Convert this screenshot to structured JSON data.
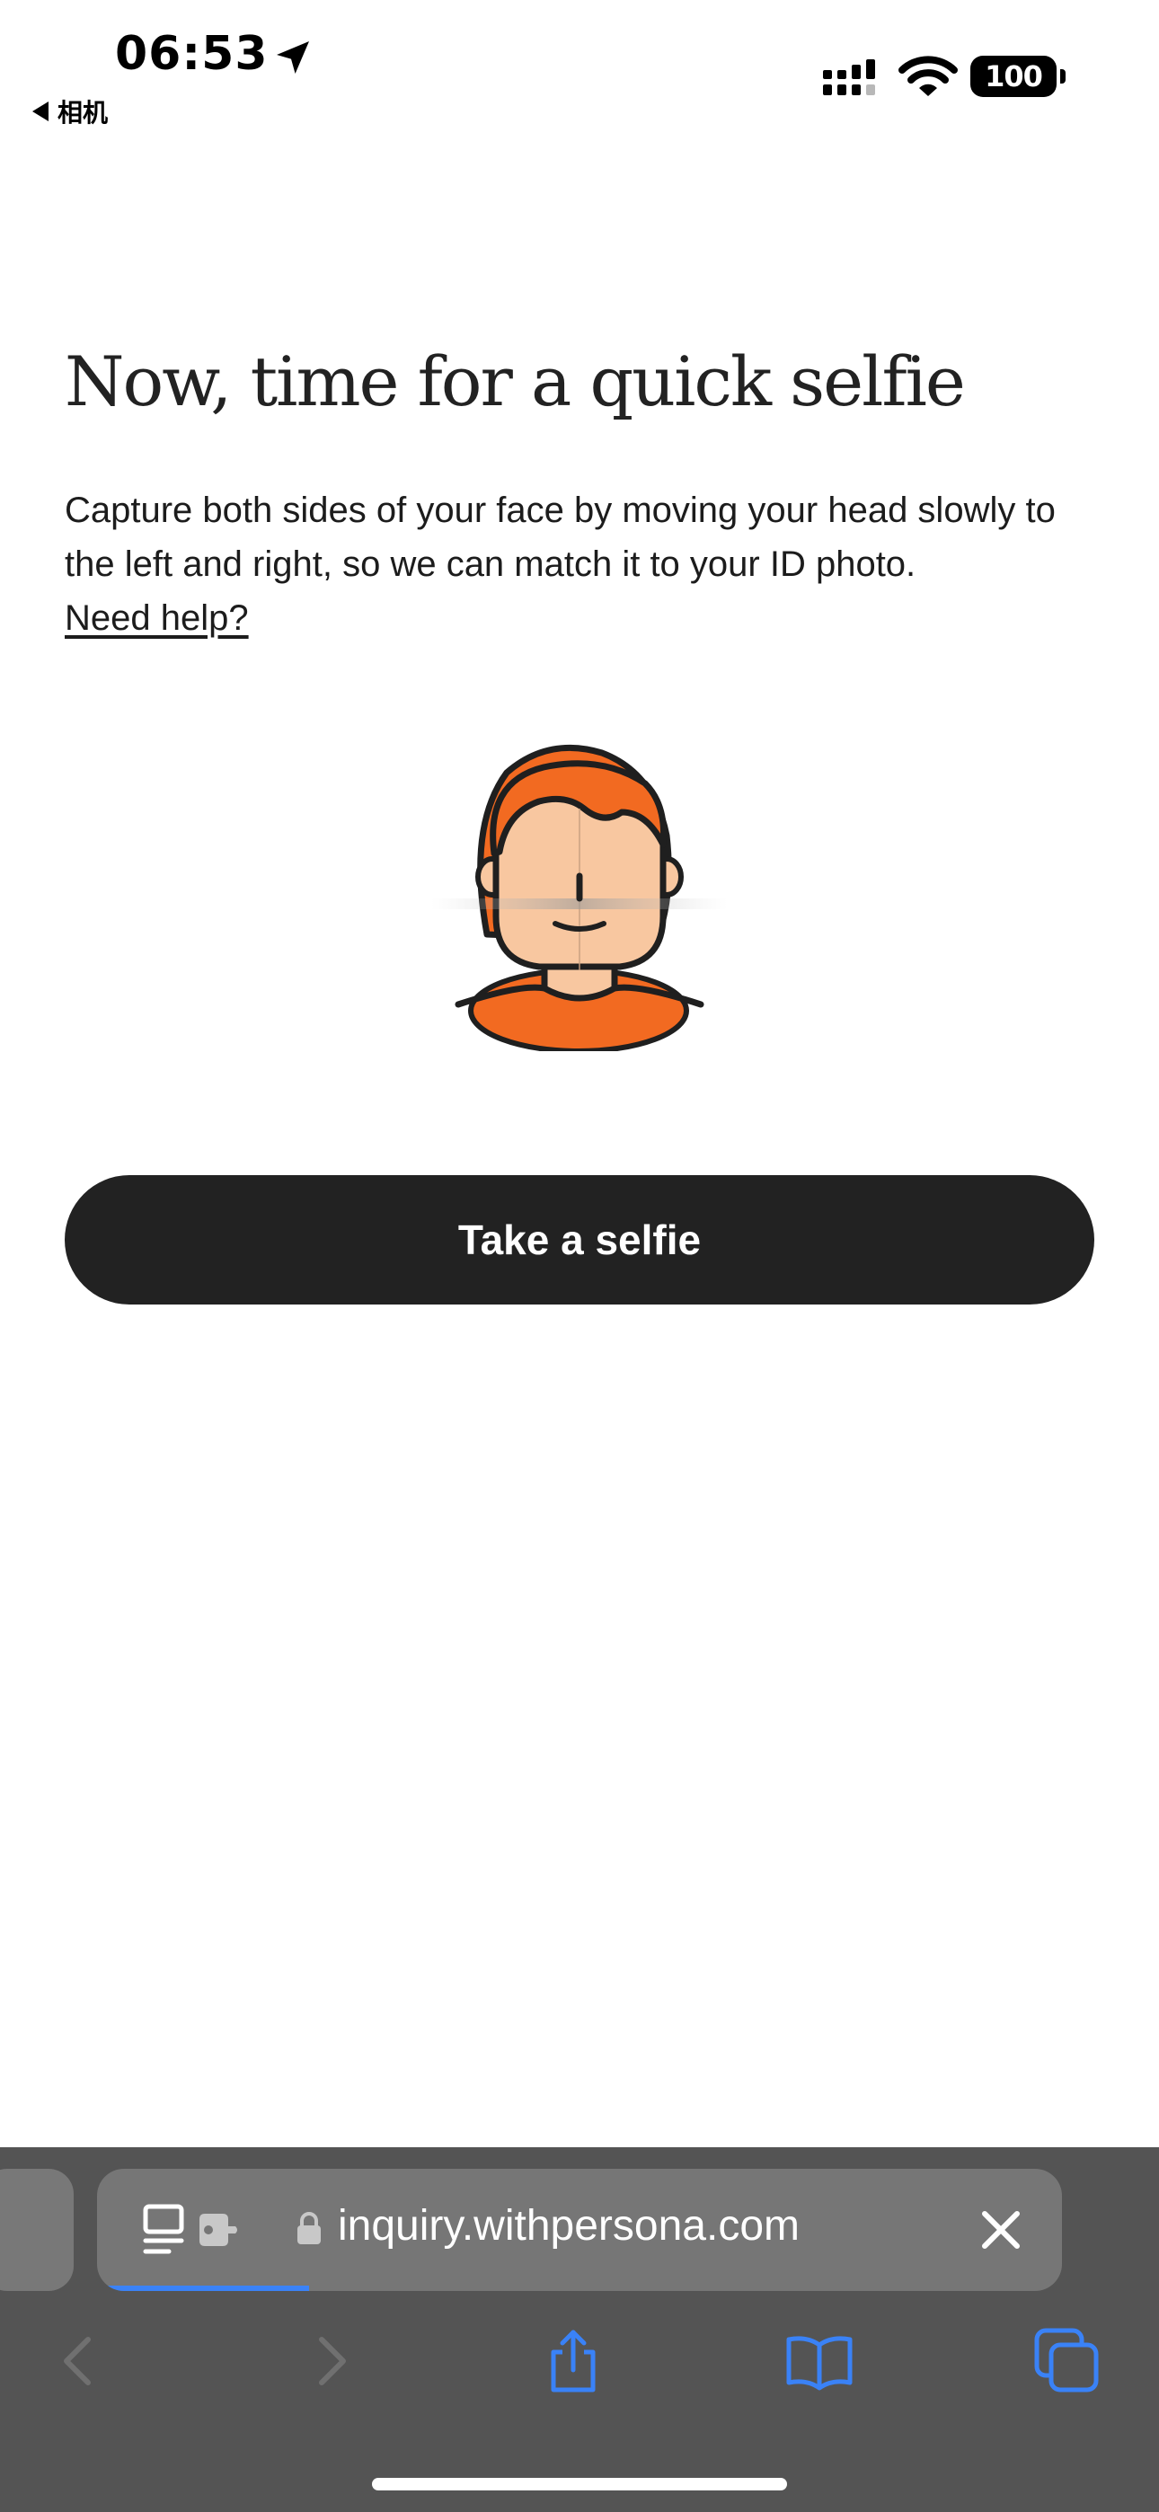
{
  "status_bar": {
    "time": "06:53",
    "back_app_label": "相机",
    "battery_level": "100"
  },
  "page": {
    "title": "Now, time for a quick selfie",
    "description": "Capture both sides of your face by moving your head slowly to the left and right, so we can match it to your ID photo.",
    "help_link": "Need help?",
    "primary_button": "Take a selfie"
  },
  "illustration": {
    "icon": "person-face-illustration",
    "hair_color": "#F26A21",
    "skin_color": "#F8C7A0",
    "shirt_color": "#F26A21"
  },
  "browser": {
    "url": "inquiry.withpersona.com",
    "load_progress": 0.22,
    "accent_color": "#3A82F7",
    "toolbar": [
      {
        "icon": "back-chevron-icon",
        "enabled": false
      },
      {
        "icon": "forward-chevron-icon",
        "enabled": false
      },
      {
        "icon": "share-icon",
        "enabled": true
      },
      {
        "icon": "bookmarks-icon",
        "enabled": true
      },
      {
        "icon": "tabs-icon",
        "enabled": true
      }
    ]
  }
}
